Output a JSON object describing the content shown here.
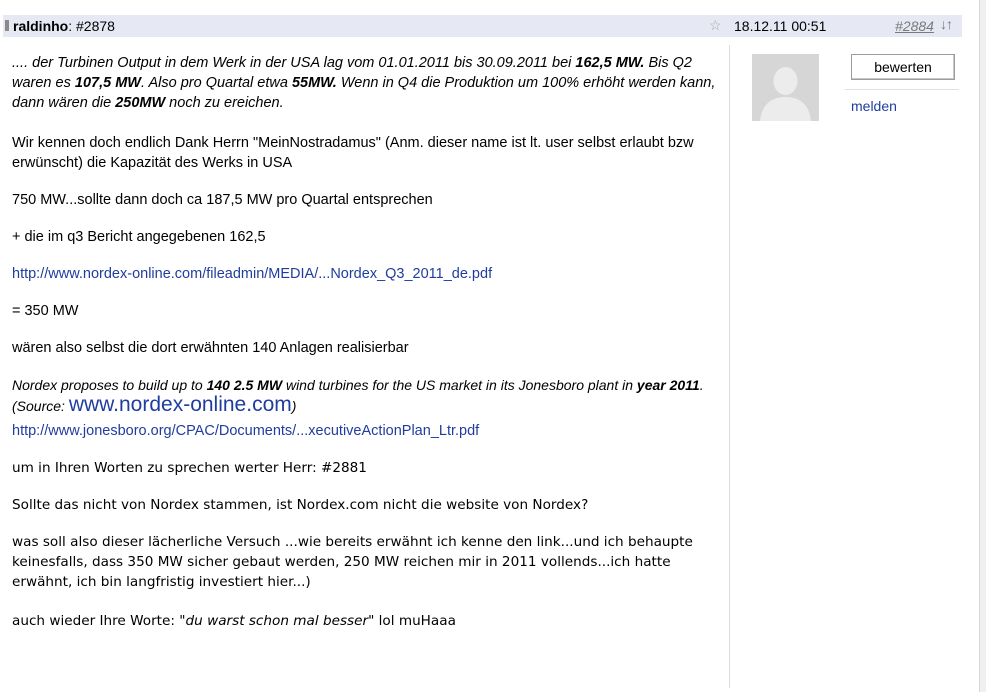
{
  "header": {
    "user": "raldinho",
    "post_ref": ": #2878",
    "date": "18.12.11 00:51",
    "post_number": "#2884",
    "nav_arrows": "↓↑"
  },
  "sidebar": {
    "rate_button": "bewerten",
    "report_link": "melden"
  },
  "post": {
    "p1": {
      "t1": ".... der Turbinen Output in dem Werk in der USA lag vom 01.01.2011 bis 30.09.2011 bei ",
      "b1": "162,5 MW.",
      "t2": " Bis Q2 waren es ",
      "b2": "107,5 MW",
      "t3": ". Also pro Quartal etwa ",
      "b3": "55MW.",
      "t4": " Wenn in Q4 die Produktion um 100% erhöht werden kann, dann wären die ",
      "b4": "250MW",
      "t5": " noch zu ereichen."
    },
    "p2": "Wir kennen doch endlich Dank Herrn \"MeinNostradamus\" (Anm. dieser name ist lt. user selbst erlaubt bzw erwünscht) die Kapazität des Werks in USA",
    "p3": "750 MW...sollte dann doch ca 187,5 MW pro Quartal entsprechen",
    "p4": "+ die im q3 Bericht angegebenen 162,5",
    "link1": "http://www.nordex-online.com/fileadmin/MEDIA/...Nordex_Q3_2011_de.pdf",
    "p5": "= 350 MW",
    "p6": "wären also selbst die dort erwähnten 140 Anlagen realisierbar",
    "quote": {
      "t1": "Nordex proposes to build up to ",
      "b1": "140 2.5 MW",
      "t2": " wind turbines for the US market in its Jonesboro plant in ",
      "b2": "year 2011",
      "t3": ". (Source: ",
      "source_link": "www.nordex-online.com",
      "t4": ")"
    },
    "link2": "http://www.jonesboro.org/CPAC/Documents/...xecutiveActionPlan_Ltr.pdf",
    "p7": "um in Ihren Worten zu sprechen werter Herr: #2881",
    "p8": "Sollte das nicht von Nordex stammen, ist Nordex.com nicht die website von Nordex?",
    "p9": "was soll also dieser lächerliche Versuch ...wie bereits erwähnt ich kenne den link...und ich behaupte keinesfalls, dass 350 MW sicher gebaut werden, 250 MW reichen mir in 2011 vollends...ich hatte erwähnt, ich bin langfristig investiert hier...)",
    "p10": {
      "t1": "auch wieder Ihre Worte: \"",
      "i1": "du warst schon mal besser",
      "t2": "\" lol muHaaa"
    }
  }
}
